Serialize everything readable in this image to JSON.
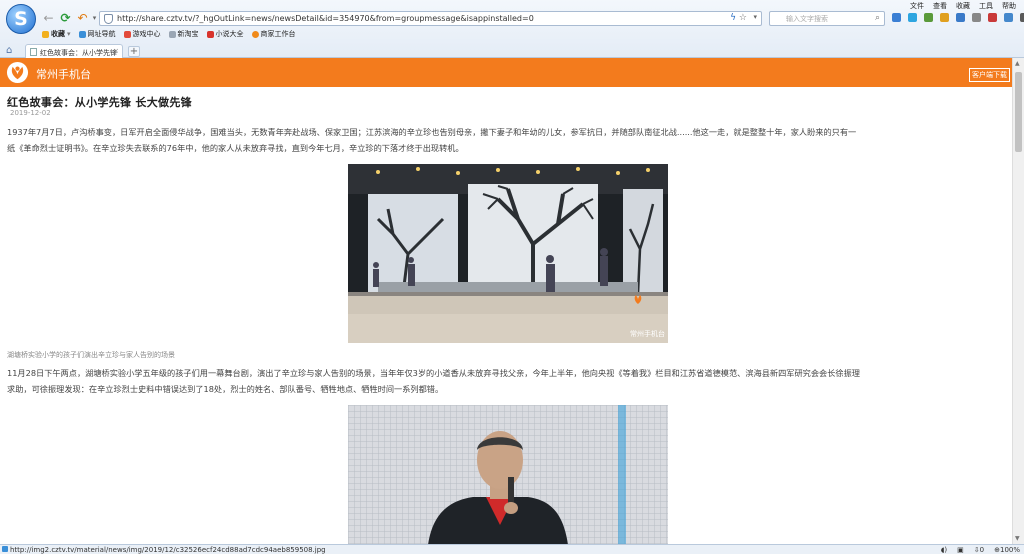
{
  "browser": {
    "menu": [
      "文件",
      "查看",
      "收藏",
      "工具",
      "帮助"
    ],
    "url": "http://share.cztv.tv/?_hgOutLink=news/newsDetail&id=354970&from=groupmessage&isappinstalled=0",
    "search_placeholder": "输入文字搜索",
    "favorites": [
      "收藏",
      "网址导航",
      "游戏中心",
      "新淘宝",
      "小说大全",
      "商家工作台"
    ],
    "tab_title": "红色故事会：从小学先锋",
    "tab_close": "×",
    "new_tab": "+",
    "status_url": "http://img2.cztv.tv/material/news/img/2019/12/c32526ecf24cd88ad7cdc94aeb859508.jpg",
    "status_count": "0",
    "zoom": "100%"
  },
  "site": {
    "name": "常州手机台",
    "download_button": "客户端下载"
  },
  "article": {
    "title": "红色故事会：从小学先锋  长大做先锋",
    "date": "2019-12-02",
    "para1_line1": "1937年7月7日，卢沟桥事变，日军开启全面侵华战争，国难当头，无数青年奔赴战场、保家卫国；江苏滨海的辛立珍也告别母亲，撇下妻子和年幼的儿女，参军抗日，并随部队南征北战......他这一走，就是整整十年，家人盼来的只有一",
    "para1_line2": "纸《革命烈士证明书》。在辛立珍失去联系的76年中，他的家人从未放弃寻找，直到今年七月，辛立珍的下落才终于出现转机。",
    "image1_watermark": "常州手机台",
    "caption1": "湖塘桥实验小学的孩子们演出辛立珍与家人告别的场景",
    "para2_line1": "11月28日下午两点，湖塘桥实验小学五年级的孩子们用一幕舞台剧，演出了辛立珍与家人告别的场景，当年年仅3岁的小道香从未放弃寻找父亲，今年上半年，他向央视《等着我》栏目和江苏省道德模范、滨海县新四军研究会会长徐振理",
    "para2_line2": "求助，可徐振理发现：在辛立珍烈士史料中错误达到了18处，烈士的姓名、部队番号、牺牲地点、牺牲时间一系列都错。"
  },
  "colors": {
    "brand_orange": "#f37b1d"
  }
}
